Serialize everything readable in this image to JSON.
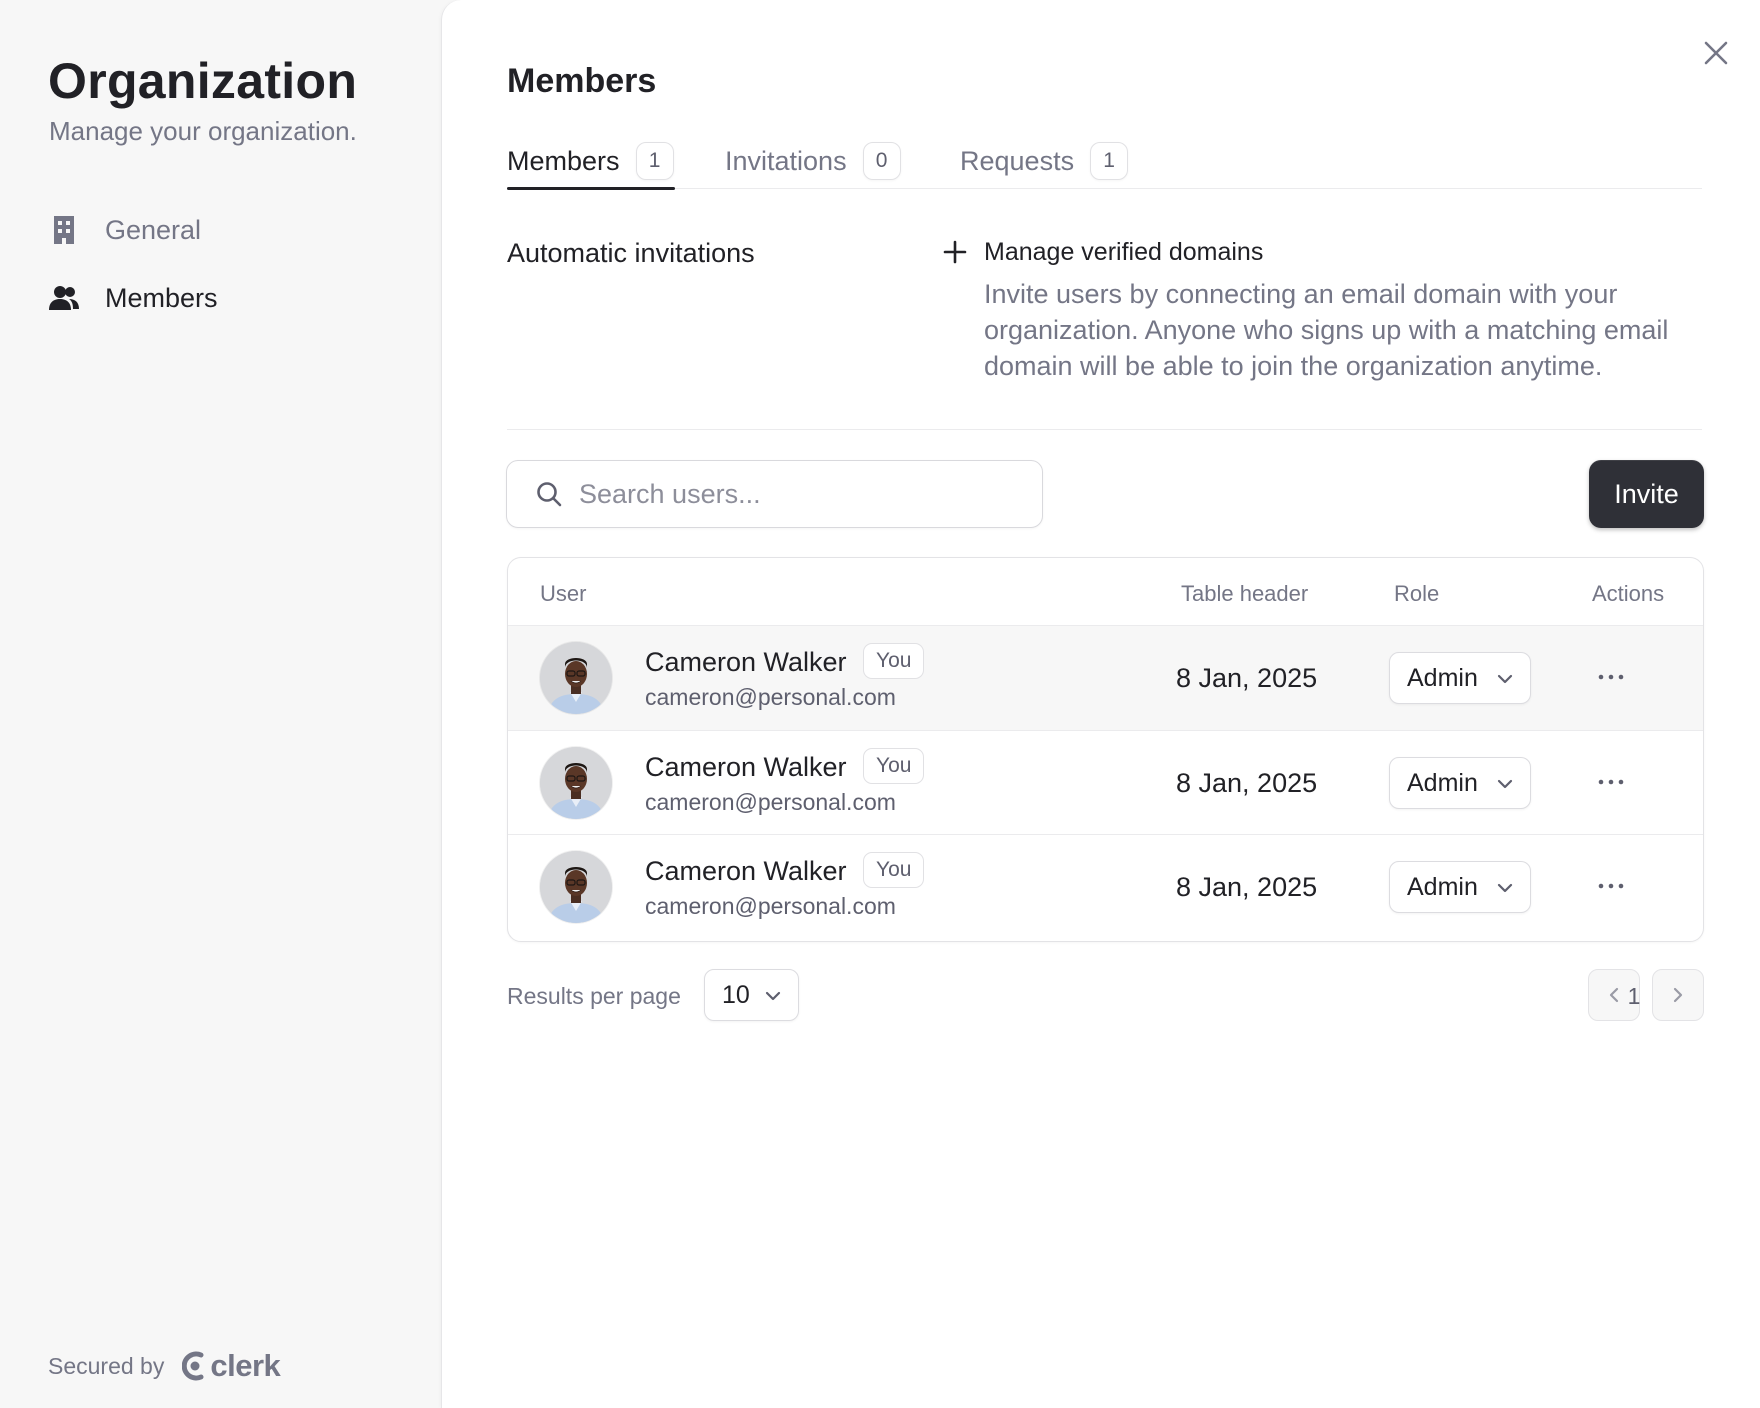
{
  "sidebar": {
    "title": "Organization",
    "subtitle": "Manage your organization.",
    "items": [
      {
        "label": "General",
        "icon": "building-icon",
        "active": false
      },
      {
        "label": "Members",
        "icon": "users-icon",
        "active": true
      }
    ],
    "footer": {
      "secured_by": "Secured by",
      "brand": "clerk"
    }
  },
  "main": {
    "title": "Members",
    "tabs": [
      {
        "label": "Members",
        "count": "1",
        "active": true
      },
      {
        "label": "Invitations",
        "count": "0",
        "active": false
      },
      {
        "label": "Requests",
        "count": "1",
        "active": false
      }
    ],
    "automatic_invitations": {
      "label": "Automatic invitations",
      "action_title": "Manage verified domains",
      "description": "Invite users by connecting an email domain with your organization. Anyone who signs up with a matching email domain will be able to join the organization anytime."
    },
    "search": {
      "placeholder": "Search users...",
      "value": ""
    },
    "invite_label": "Invite",
    "table": {
      "headers": {
        "user": "User",
        "date": "Table header",
        "role": "Role",
        "actions": "Actions"
      },
      "rows": [
        {
          "name": "Cameron Walker",
          "badge": "You",
          "email": "cameron@personal.com",
          "date": "8 Jan, 2025",
          "role": "Admin"
        },
        {
          "name": "Cameron Walker",
          "badge": "You",
          "email": "cameron@personal.com",
          "date": "8 Jan, 2025",
          "role": "Admin"
        },
        {
          "name": "Cameron Walker",
          "badge": "You",
          "email": "cameron@personal.com",
          "date": "8 Jan, 2025",
          "role": "Admin"
        }
      ]
    },
    "pagination": {
      "results_per_page_label": "Results per page",
      "results_per_page_value": "10",
      "current_page": "1"
    }
  },
  "colors": {
    "primary_text": "#212126",
    "muted_text": "#747686",
    "invite_button": "#2f3037",
    "sidebar_bg": "#f7f7f7"
  }
}
